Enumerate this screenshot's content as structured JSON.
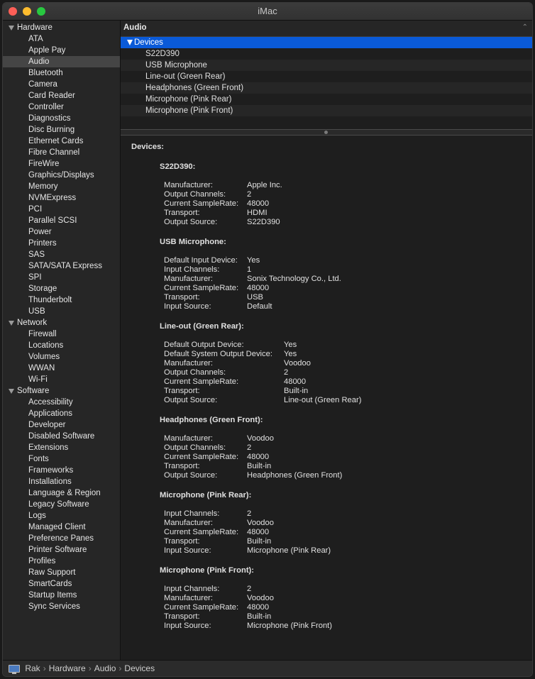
{
  "window": {
    "title": "iMac"
  },
  "sidebar": {
    "groups": [
      {
        "label": "Hardware",
        "items": [
          "ATA",
          "Apple Pay",
          "Audio",
          "Bluetooth",
          "Camera",
          "Card Reader",
          "Controller",
          "Diagnostics",
          "Disc Burning",
          "Ethernet Cards",
          "Fibre Channel",
          "FireWire",
          "Graphics/Displays",
          "Memory",
          "NVMExpress",
          "PCI",
          "Parallel SCSI",
          "Power",
          "Printers",
          "SAS",
          "SATA/SATA Express",
          "SPI",
          "Storage",
          "Thunderbolt",
          "USB"
        ]
      },
      {
        "label": "Network",
        "items": [
          "Firewall",
          "Locations",
          "Volumes",
          "WWAN",
          "Wi-Fi"
        ]
      },
      {
        "label": "Software",
        "items": [
          "Accessibility",
          "Applications",
          "Developer",
          "Disabled Software",
          "Extensions",
          "Fonts",
          "Frameworks",
          "Installations",
          "Language & Region",
          "Legacy Software",
          "Logs",
          "Managed Client",
          "Preference Panes",
          "Printer Software",
          "Profiles",
          "Raw Support",
          "SmartCards",
          "Startup Items",
          "Sync Services"
        ]
      }
    ],
    "selected": "Audio"
  },
  "main": {
    "header": "Audio",
    "list": {
      "group": "Devices",
      "items": [
        "S22D390",
        "USB Microphone",
        "Line-out (Green Rear)",
        "Headphones (Green Front)",
        "Microphone (Pink Rear)",
        "Microphone (Pink Front)"
      ]
    },
    "detail": {
      "heading": "Devices:",
      "devices": [
        {
          "name": "S22D390:",
          "props": [
            [
              "Manufacturer:",
              "Apple Inc."
            ],
            [
              "Output Channels:",
              "2"
            ],
            [
              "Current SampleRate:",
              "48000"
            ],
            [
              "Transport:",
              "HDMI"
            ],
            [
              "Output Source:",
              "S22D390"
            ]
          ]
        },
        {
          "name": "USB Microphone:",
          "props": [
            [
              "Default Input Device:",
              "Yes"
            ],
            [
              "Input Channels:",
              "1"
            ],
            [
              "Manufacturer:",
              "Sonix Technology Co., Ltd."
            ],
            [
              "Current SampleRate:",
              "48000"
            ],
            [
              "Transport:",
              "USB"
            ],
            [
              "Input Source:",
              "Default"
            ]
          ]
        },
        {
          "name": "Line-out (Green Rear):",
          "props": [
            [
              "Default Output Device:",
              "Yes"
            ],
            [
              "Default System Output Device:",
              "Yes"
            ],
            [
              "Manufacturer:",
              "Voodoo"
            ],
            [
              "Output Channels:",
              "2"
            ],
            [
              "Current SampleRate:",
              "48000"
            ],
            [
              "Transport:",
              "Built-in"
            ],
            [
              "Output Source:",
              "Line-out (Green Rear)"
            ]
          ]
        },
        {
          "name": "Headphones (Green Front):",
          "props": [
            [
              "Manufacturer:",
              "Voodoo"
            ],
            [
              "Output Channels:",
              "2"
            ],
            [
              "Current SampleRate:",
              "48000"
            ],
            [
              "Transport:",
              "Built-in"
            ],
            [
              "Output Source:",
              "Headphones (Green Front)"
            ]
          ]
        },
        {
          "name": "Microphone (Pink Rear):",
          "props": [
            [
              "Input Channels:",
              "2"
            ],
            [
              "Manufacturer:",
              "Voodoo"
            ],
            [
              "Current SampleRate:",
              "48000"
            ],
            [
              "Transport:",
              "Built-in"
            ],
            [
              "Input Source:",
              "Microphone (Pink Rear)"
            ]
          ]
        },
        {
          "name": "Microphone (Pink Front):",
          "props": [
            [
              "Input Channels:",
              "2"
            ],
            [
              "Manufacturer:",
              "Voodoo"
            ],
            [
              "Current SampleRate:",
              "48000"
            ],
            [
              "Transport:",
              "Built-in"
            ],
            [
              "Input Source:",
              "Microphone (Pink Front)"
            ]
          ]
        }
      ]
    }
  },
  "statusbar": {
    "breadcrumb": [
      "Rak",
      "Hardware",
      "Audio",
      "Devices"
    ]
  },
  "icons": {
    "status": "monitor-icon"
  }
}
